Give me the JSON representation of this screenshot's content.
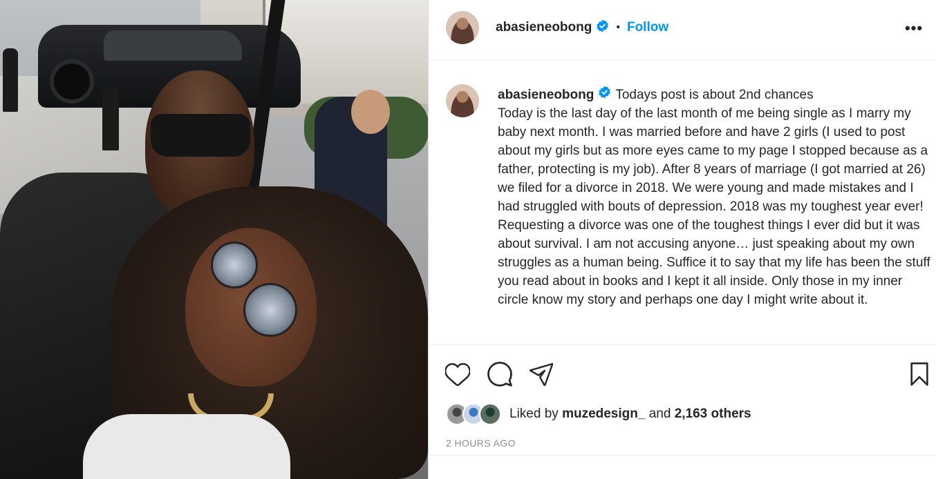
{
  "post": {
    "username": "abasieneobong",
    "verified_icon": "verified-badge-icon",
    "separator": "•",
    "follow_label": "Follow",
    "more_label": "•••"
  },
  "caption": {
    "username": "abasieneobong",
    "text": "Todays post is about 2nd chances\nToday is the last day of the last month of me being single as I marry my baby next month. I was married before and have 2 girls (I used to post about my girls but as more eyes came to my page I stopped because as a father, protecting is my job). After 8 years of marriage (I got married at 26) we filed for a divorce in 2018. We were young and made mistakes and I had struggled with bouts of depression. 2018 was my toughest year ever! Requesting a divorce was one of the toughest things I ever did but it was about survival. I am not accusing anyone… just speaking about my own struggles as a human being. Suffice it to say that my life has been the stuff you read about in books and I kept it all inside. Only those in my inner circle know my story and perhaps one day I might write about it."
  },
  "actions": {
    "like_icon": "heart-icon",
    "comment_icon": "comment-icon",
    "share_icon": "paper-plane-icon",
    "save_icon": "bookmark-icon"
  },
  "likes": {
    "prefix": "Liked by",
    "user": "muzedesign_",
    "middle": "and",
    "others": "2,163 others"
  },
  "timestamp": "2 HOURS AGO",
  "colors": {
    "accent": "#0095f6",
    "text": "#262626",
    "muted": "#8e8e8e",
    "border": "#dbdbdb"
  }
}
